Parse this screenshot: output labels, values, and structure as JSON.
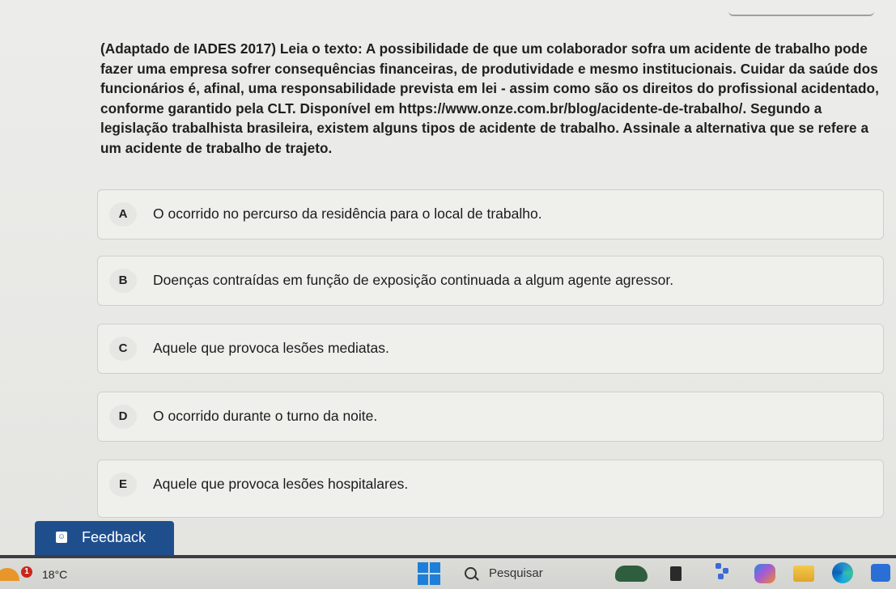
{
  "question": {
    "text": "(Adaptado de IADES 2017) Leia o texto: A possibilidade de que um colaborador sofra um acidente de trabalho pode fazer uma empresa sofrer consequências financeiras, de produtividade e mesmo institucionais. Cuidar da saúde dos funcionários é, afinal, uma responsabilidade prevista em lei - assim como são os direitos do profissional acidentado, conforme garantido pela CLT. Disponível em https://www.onze.com.br/blog/acidente-de-trabalho/. Segundo a legislação trabalhista brasileira, existem alguns tipos de acidente de trabalho. Assinale a alternativa que se refere a um acidente de trabalho de trajeto."
  },
  "options": [
    {
      "letter": "A",
      "text": "O ocorrido no percurso da residência para o local de trabalho."
    },
    {
      "letter": "B",
      "text": "Doenças contraídas em função de exposição continuada a algum agente agressor."
    },
    {
      "letter": "C",
      "text": "Aquele que provoca lesões mediatas."
    },
    {
      "letter": "D",
      "text": "O ocorrido durante o turno da noite."
    },
    {
      "letter": "E",
      "text": "Aquele que provoca lesões hospitalares."
    }
  ],
  "feedback": {
    "label": "Feedback",
    "icon": "smiley-feedback-icon",
    "color": "#1f4e8d"
  },
  "taskbar": {
    "weather": {
      "badge": "1",
      "temperature": "18°C"
    },
    "search": {
      "placeholder": "Pesquisar"
    },
    "icons": [
      "windows-start-icon",
      "search-icon",
      "turtle-app-icon",
      "dark-app-icon",
      "widgets-icon",
      "copilot-icon",
      "file-explorer-icon",
      "edge-icon",
      "store-icon"
    ]
  }
}
